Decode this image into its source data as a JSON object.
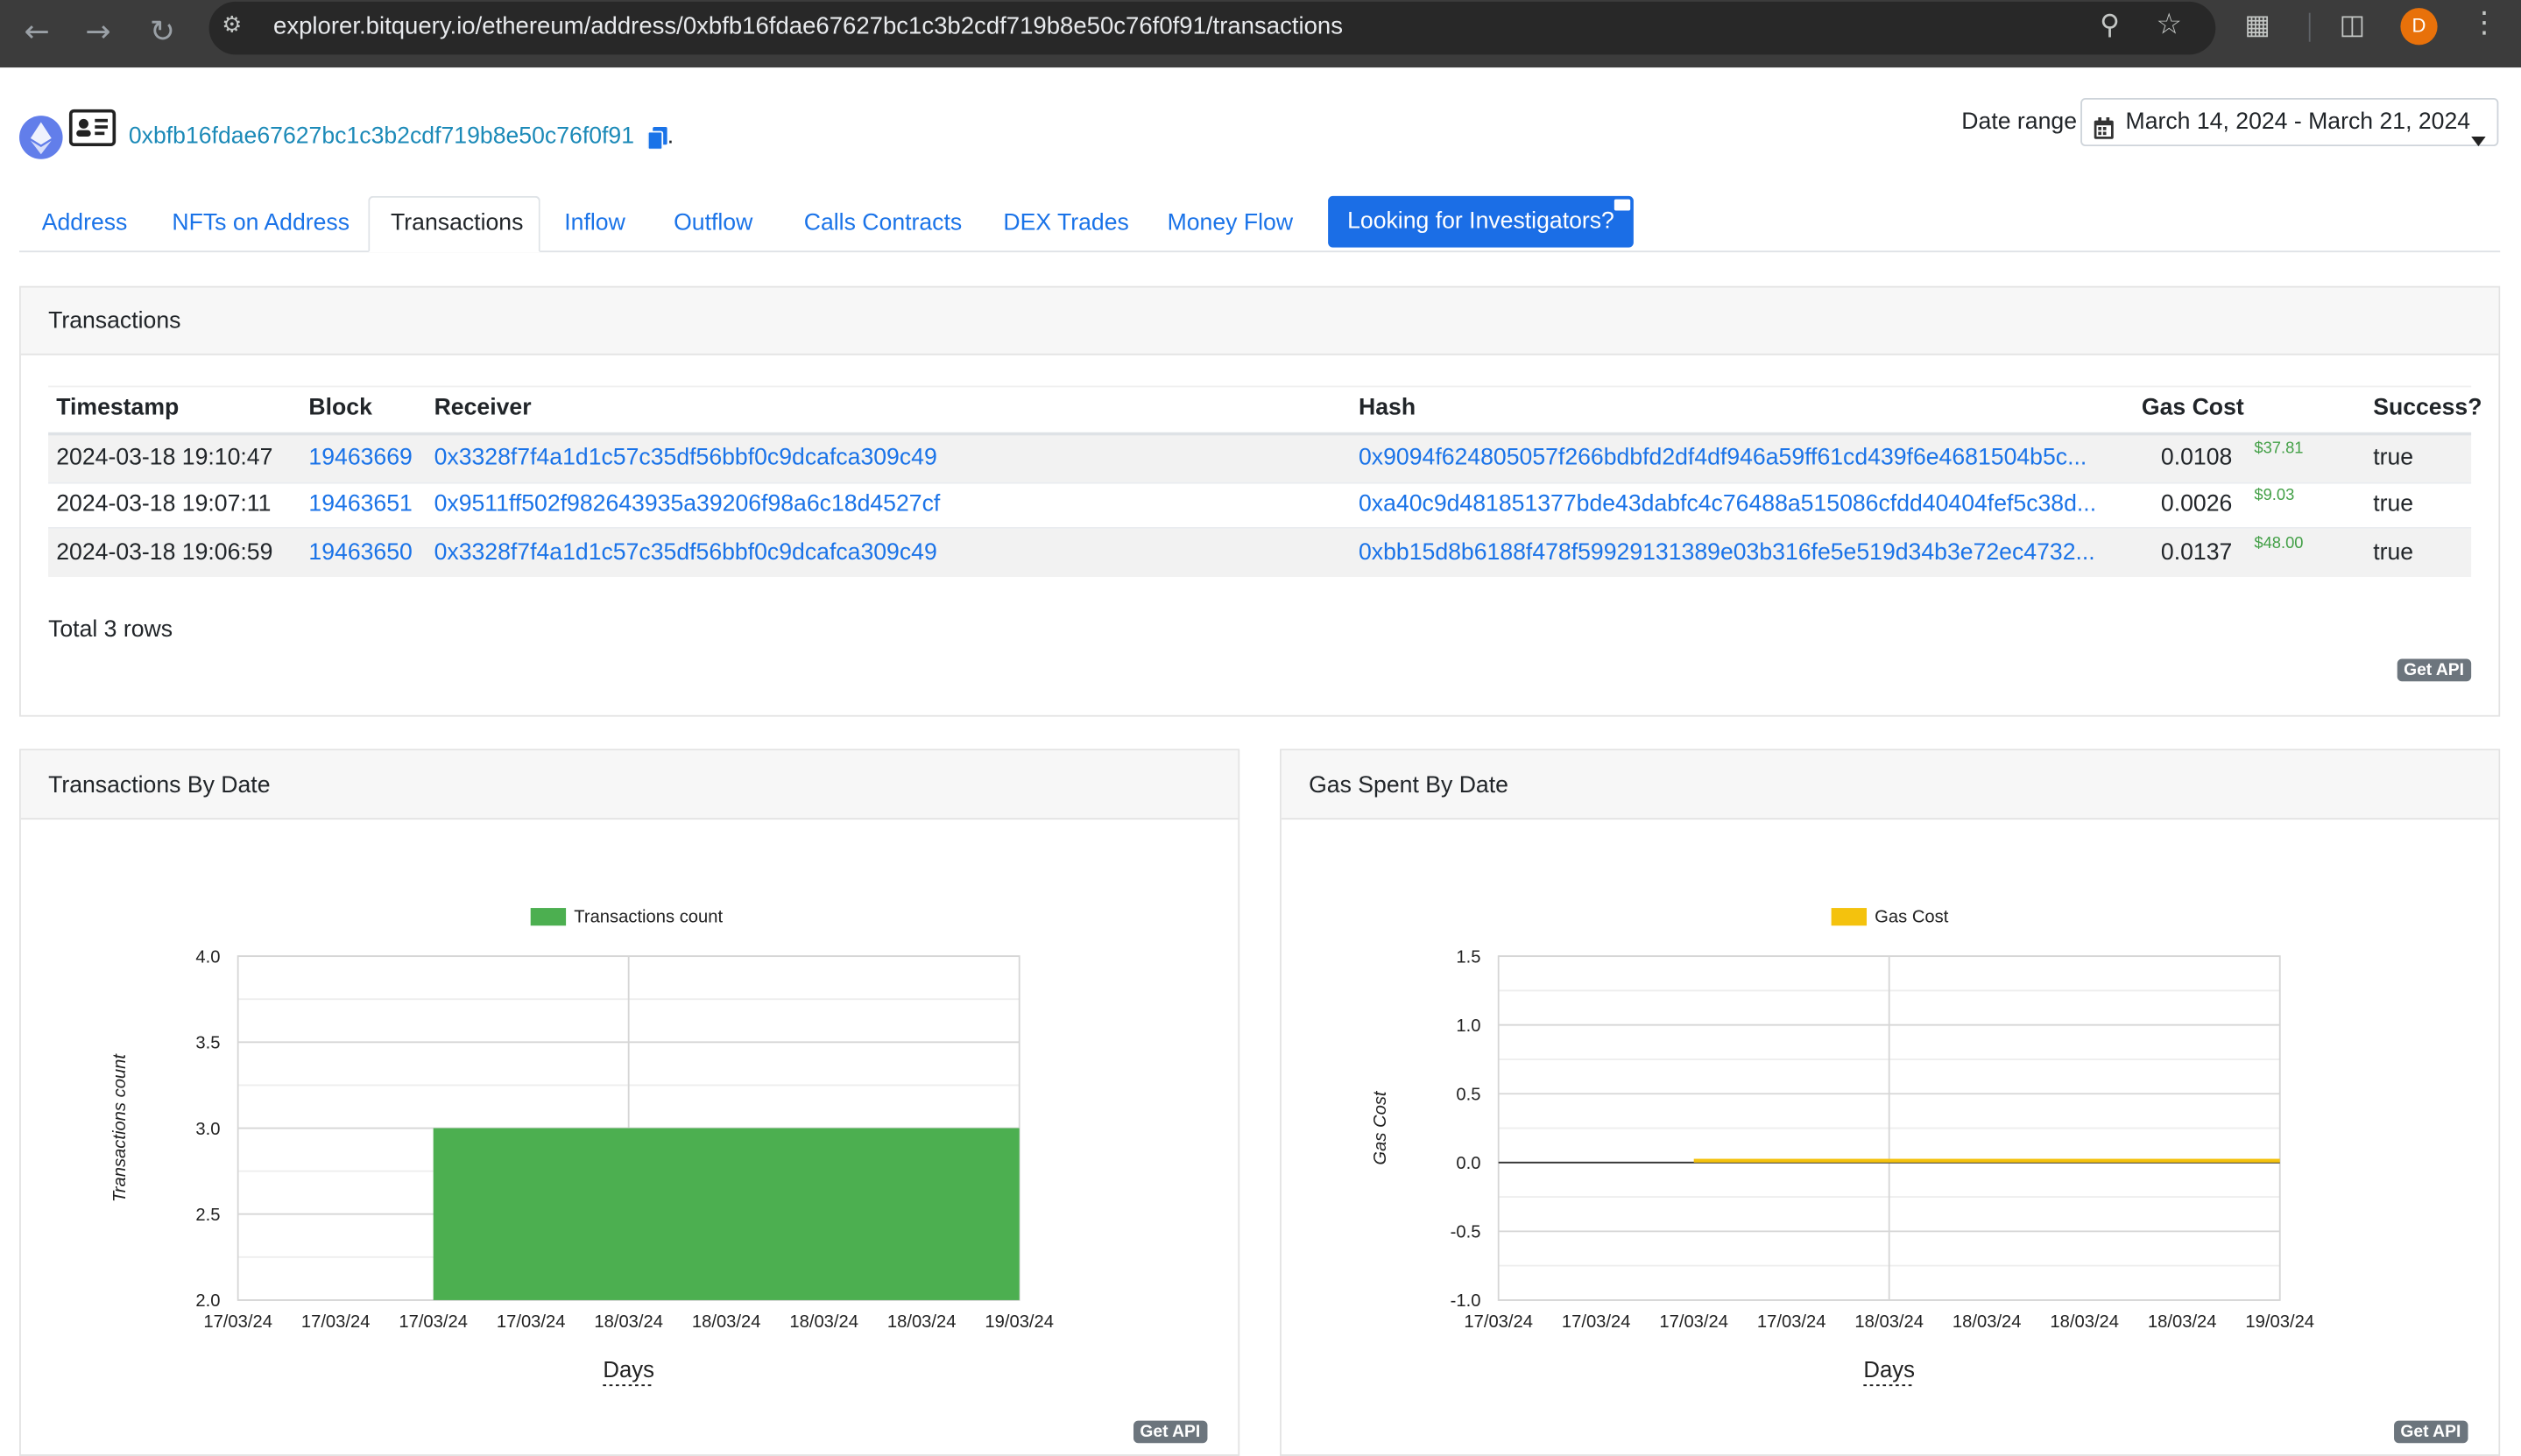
{
  "browser": {
    "url": "explorer.bitquery.io/ethereum/address/0xbfb16fdae67627bc1c3b2cdf719b8e50c76f0f91/transactions",
    "profile_initial": "D"
  },
  "header": {
    "address": "0xbfb16fdae67627bc1c3b2cdf719b8e50c76f0f91",
    "date_range_label": "Date range",
    "date_range_value": "March 14, 2024 - March 21, 2024"
  },
  "tabs": {
    "address": "Address",
    "nfts": "NFTs on Address",
    "transactions": "Transactions",
    "inflow": "Inflow",
    "outflow": "Outflow",
    "calls": "Calls Contracts",
    "dex": "DEX Trades",
    "money_flow": "Money Flow",
    "investigators": "Looking for Investigators?"
  },
  "transactions": {
    "title": "Transactions",
    "columns": [
      "Timestamp",
      "Block",
      "Receiver",
      "Hash",
      "Gas Cost",
      "Success?"
    ],
    "rows": [
      {
        "timestamp": "2024-03-18 19:10:47",
        "block": "19463669",
        "receiver": "0x3328f7f4a1d1c57c35df56bbf0c9dcafca309c49",
        "hash": "0x9094f624805057f266bdbfd2df4df946a59ff61cd439f6e4681504b5c...",
        "gas": "0.0108",
        "usd": "$37.81",
        "success": "true"
      },
      {
        "timestamp": "2024-03-18 19:07:11",
        "block": "19463651",
        "receiver": "0x9511ff502f982643935a39206f98a6c18d4527cf",
        "hash": "0xa40c9d481851377bde43dabfc4c76488a515086cfdd40404fef5c38d...",
        "gas": "0.0026",
        "usd": "$9.03",
        "success": "true"
      },
      {
        "timestamp": "2024-03-18 19:06:59",
        "block": "19463650",
        "receiver": "0x3328f7f4a1d1c57c35df56bbf0c9dcafca309c49",
        "hash": "0xbb15d8b6188f478f59929131389e03b316fe5e519d34b3e72ec4732...",
        "gas": "0.0137",
        "usd": "$48.00",
        "success": "true"
      }
    ],
    "total": "Total 3 rows",
    "get_api": "Get API"
  },
  "panel_titles": {
    "tx_by_date": "Transactions By Date",
    "gas_by_date": "Gas Spent By Date"
  },
  "colors": {
    "link": "#1a73e8",
    "tx_bar": "#4caf50",
    "gas_line": "#f4c20d",
    "usd": "#43a047"
  },
  "chart_data": [
    {
      "type": "bar",
      "title": "",
      "legend": "Transactions count",
      "legend_position": "top",
      "xlabel": "Days",
      "ylabel": "Transactions count",
      "x_ticks": [
        "17/03/24",
        "17/03/24",
        "17/03/24",
        "17/03/24",
        "18/03/24",
        "18/03/24",
        "18/03/24",
        "18/03/24",
        "19/03/24"
      ],
      "categories": [
        "18/03/24"
      ],
      "values": [
        3
      ],
      "bar_x_range": [
        2,
        8
      ],
      "x_tick_count": 9,
      "ylim": [
        2.0,
        4.0
      ],
      "y_ticks": [
        "4.0",
        "3.5",
        "3.0",
        "2.5",
        "2.0"
      ],
      "grid": true,
      "get_api": "Get API"
    },
    {
      "type": "area",
      "title": "",
      "legend": "Gas Cost",
      "legend_position": "top",
      "xlabel": "Days",
      "ylabel": "Gas Cost",
      "x_ticks": [
        "17/03/24",
        "17/03/24",
        "17/03/24",
        "17/03/24",
        "18/03/24",
        "18/03/24",
        "18/03/24",
        "18/03/24",
        "19/03/24"
      ],
      "categories": [
        "18/03/24"
      ],
      "values": [
        0.0271
      ],
      "bar_x_range": [
        2,
        8
      ],
      "x_tick_count": 9,
      "ylim": [
        -1.0,
        1.5
      ],
      "y_ticks": [
        "1.5",
        "1.0",
        "0.5",
        "0.0",
        "-0.5",
        "-1.0"
      ],
      "grid": true,
      "get_api": "Get API"
    }
  ]
}
